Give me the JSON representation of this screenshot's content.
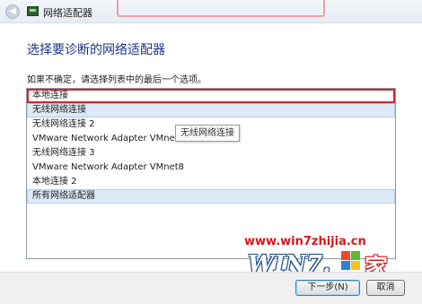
{
  "window": {
    "title": "网络适配器"
  },
  "main": {
    "heading": "选择要诊断的网络适配器",
    "hint": "如果不确定，请选择列表中的最后一个选项。",
    "items": [
      {
        "label": "本地连接"
      },
      {
        "label": "无线网络连接"
      },
      {
        "label": "无线网络连接 2"
      },
      {
        "label": "VMware Network Adapter VMnet1"
      },
      {
        "label": "无线网络连接 3"
      },
      {
        "label": "VMware Network Adapter VMnet8"
      },
      {
        "label": "本地连接 2"
      },
      {
        "label": "所有网络适配器"
      }
    ],
    "tooltip": "无线网络连接"
  },
  "footer": {
    "next_label": "下一步(N)",
    "cancel_label": "取消"
  },
  "watermark": {
    "url": "www.win7zhijia.cn",
    "logo_text": "WIN7.",
    "logo_char": "家"
  },
  "colors": {
    "heading": "#1e3287",
    "selection_border": "#d6242c",
    "highlight_row": "#dce9f7",
    "watermark_red": "#d8151a"
  },
  "icons": {
    "back": "back-arrow-icon",
    "app": "network-adapter-icon"
  }
}
